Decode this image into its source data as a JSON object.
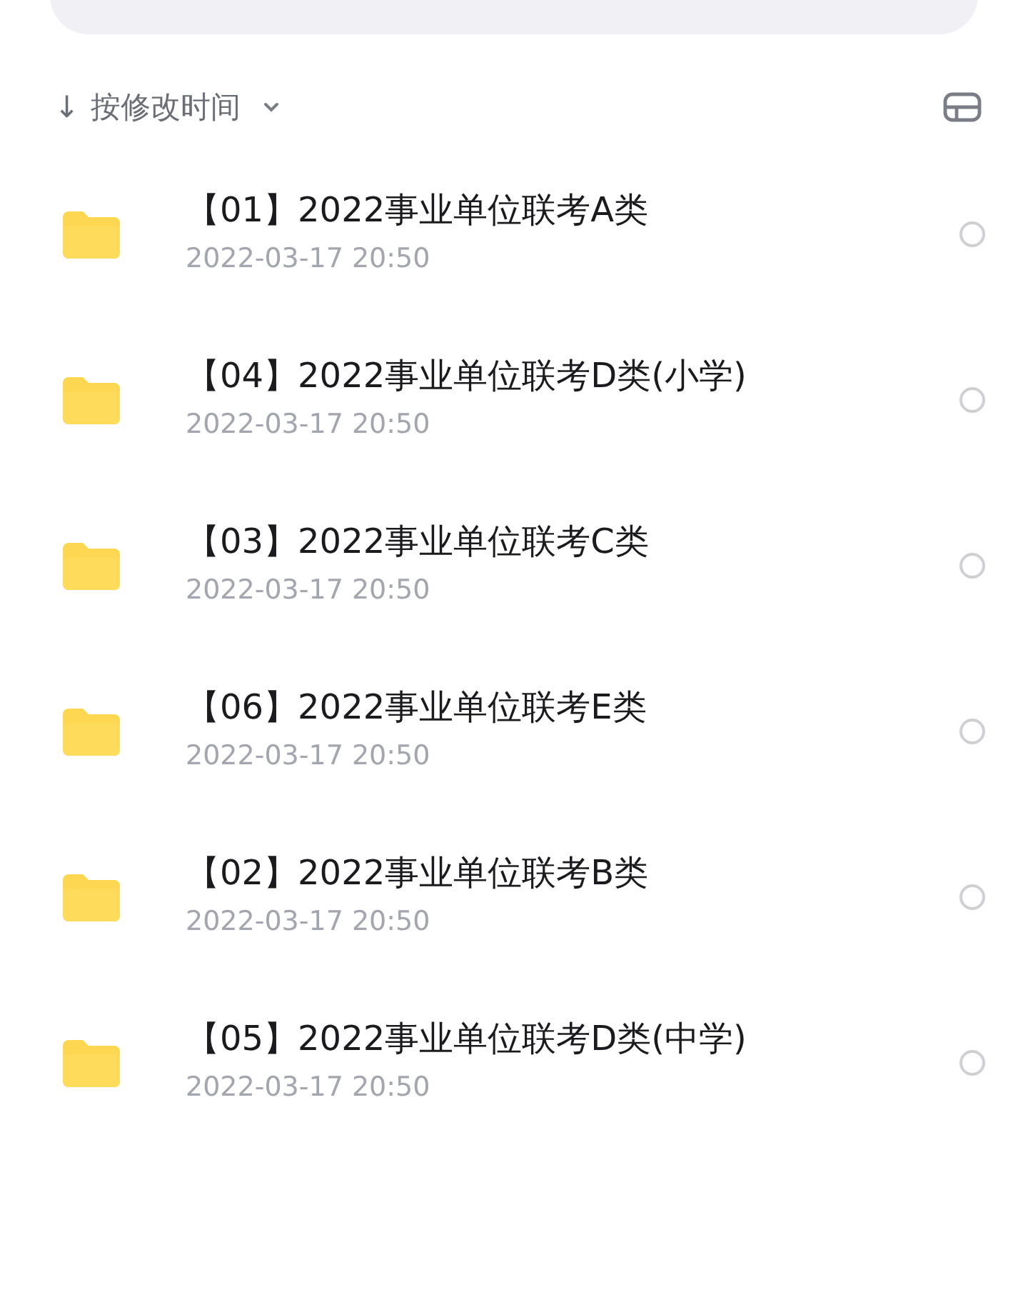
{
  "sort": {
    "arrow": "↓",
    "label": "按修改时间"
  },
  "files": [
    {
      "name": "【01】2022事业单位联考A类",
      "date": "2022-03-17 20:50",
      "selected": false
    },
    {
      "name": "【04】2022事业单位联考D类(小学)",
      "date": "2022-03-17 20:50",
      "selected": false
    },
    {
      "name": "【03】2022事业单位联考C类",
      "date": "2022-03-17 20:50",
      "selected": false
    },
    {
      "name": "【06】2022事业单位联考E类",
      "date": "2022-03-17 20:50",
      "selected": false
    },
    {
      "name": "【02】2022事业单位联考B类",
      "date": "2022-03-17 20:50",
      "selected": false
    },
    {
      "name": "【05】2022事业单位联考D类(中学)",
      "date": "2022-03-17 20:50",
      "selected": false
    }
  ]
}
